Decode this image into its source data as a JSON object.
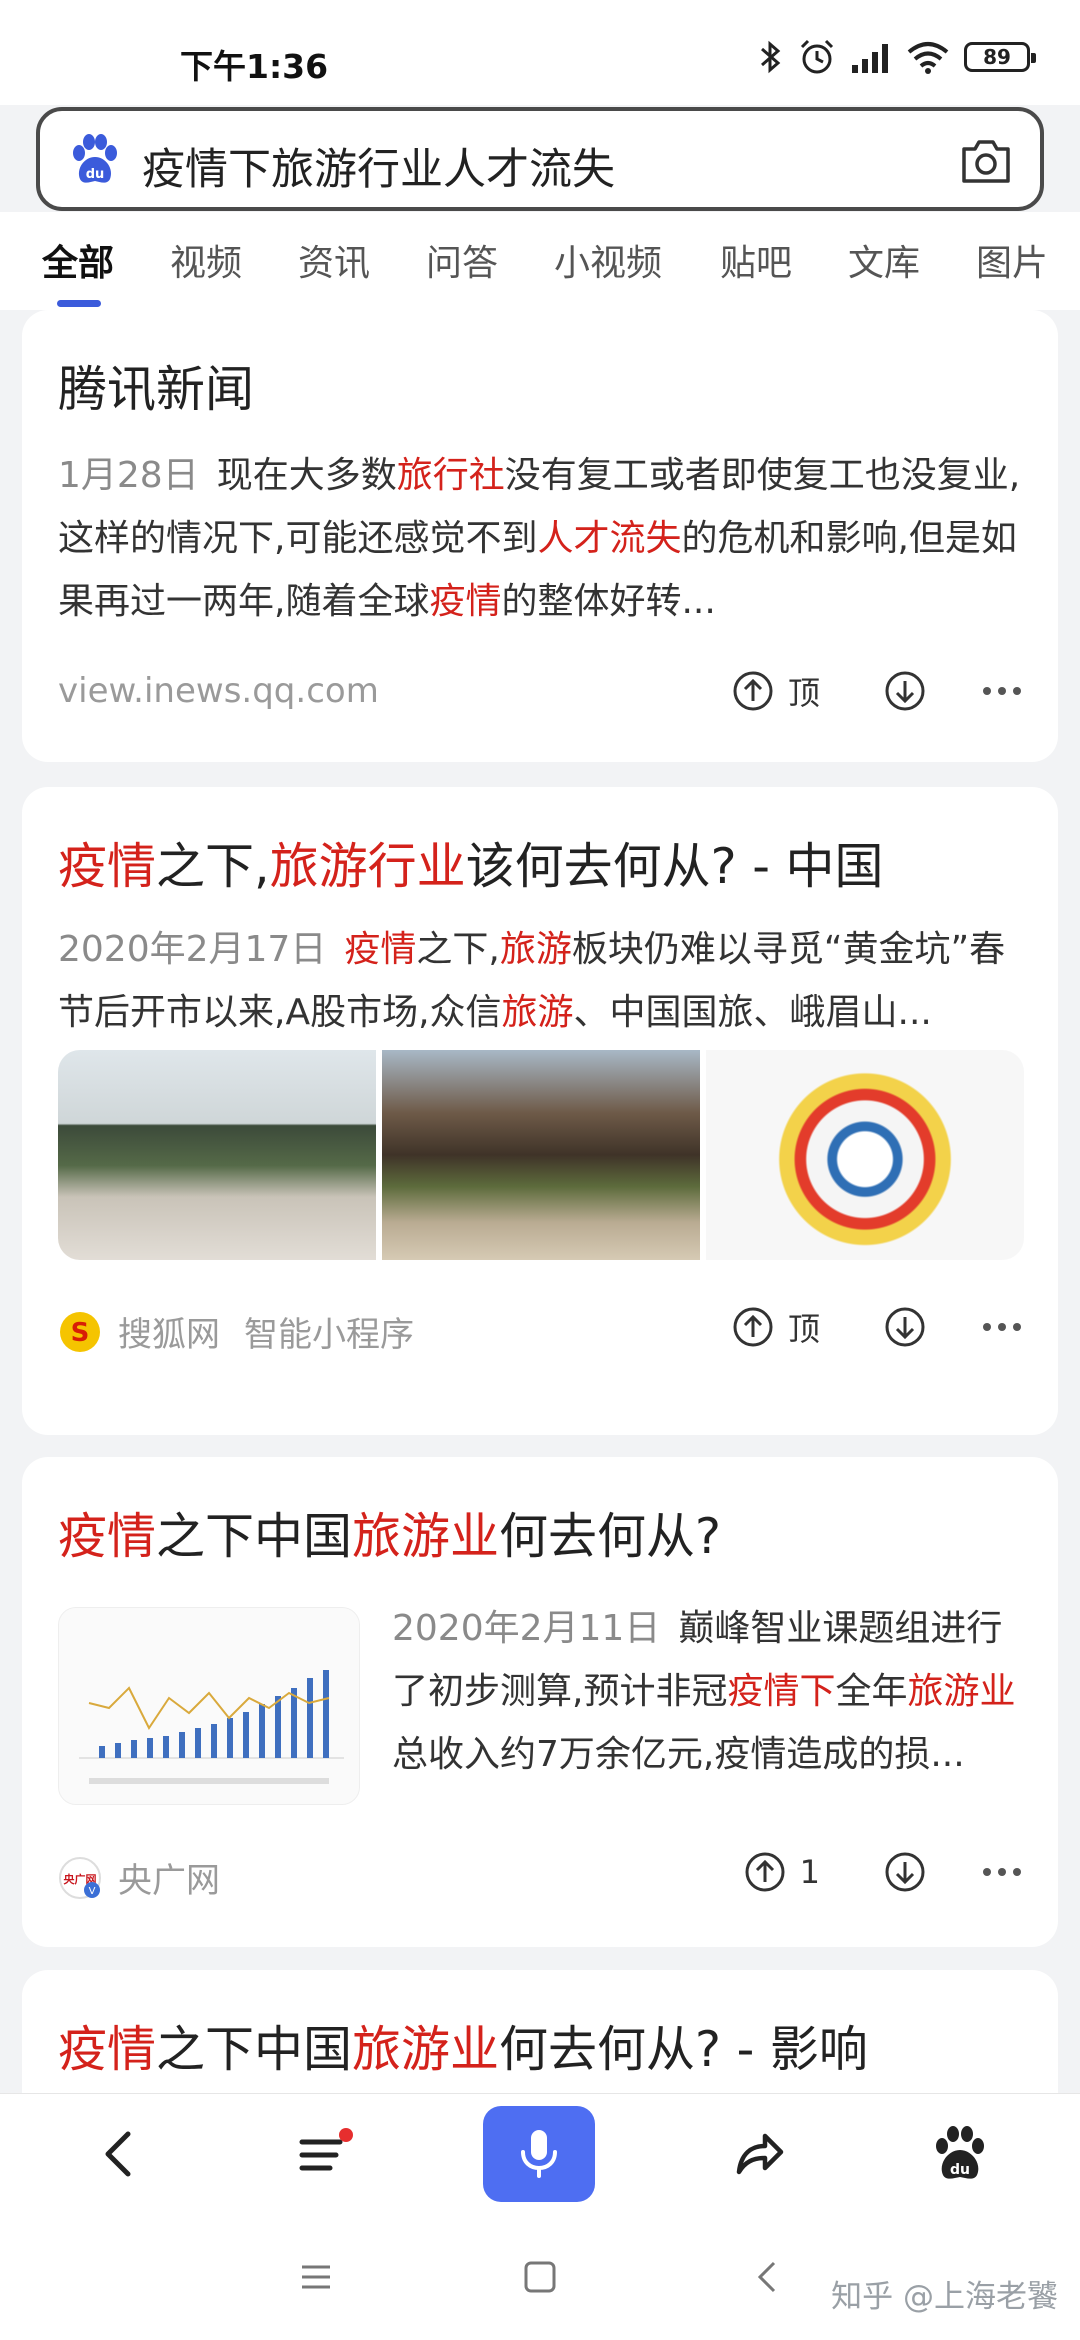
{
  "status": {
    "time": "下午1:36",
    "battery": "89"
  },
  "search": {
    "query": "疫情下旅游行业人才流失"
  },
  "tabs": [
    "全部",
    "视频",
    "资讯",
    "问答",
    "小视频",
    "贴吧",
    "文库",
    "图片"
  ],
  "results": [
    {
      "title": "腾讯新闻",
      "date": "1月28日",
      "abstract_parts": [
        "现在大多数",
        "旅行社",
        "没有复工或者即使复工也没复业,这样的情况下,可能还感觉不到",
        "人才流失",
        "的危机和影响,但是如果再过一两年,随着全球",
        "疫情",
        "的整体好转..."
      ],
      "source": "view.inews.qq.com",
      "up_label": "顶"
    },
    {
      "title_parts": [
        "疫情",
        "之下,",
        "旅游行业",
        "该何去何从? - 中国"
      ],
      "date": "2020年2月17日",
      "abstract_parts": [
        "疫情",
        "之下,",
        "旅游",
        "板块仍难以寻觅“黄金坑”春节后开市以来,A股市场,众信",
        "旅游",
        "、中国国旅、峨眉山..."
      ],
      "source": "搜狐网",
      "source_extra": "智能小程序",
      "up_label": "顶"
    },
    {
      "title_parts": [
        "疫情",
        "之下中国",
        "旅游业",
        "何去何从?"
      ],
      "date": "2020年2月11日",
      "abstract_parts": [
        "巅峰智业课题组进行了初步测算,预计非冠",
        "疫情下",
        "全年",
        "旅游业",
        "总收入约7万余亿元,疫情造成的损..."
      ],
      "source": "央广网",
      "source_badge": "央广网",
      "up_label": "1"
    },
    {
      "title_parts": [
        "疫情",
        "之下中国",
        "旅游业",
        "何去何从? - 影响"
      ]
    }
  ],
  "watermark": "知乎 @上海老饕"
}
